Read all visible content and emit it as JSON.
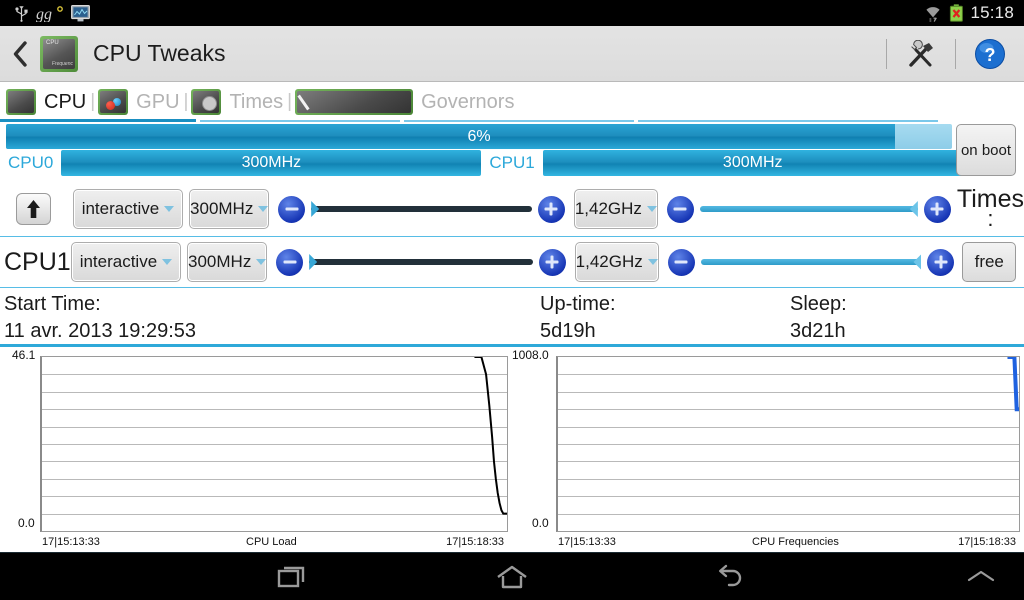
{
  "statusbar": {
    "icons": [
      "usb-icon",
      "gg-icon",
      "monitor-icon",
      "wifi-icon",
      "battery-error-icon"
    ],
    "clock": "15:18"
  },
  "actionbar": {
    "back_icon": "back-chevron-icon",
    "app_icon": "cpu-chip-icon",
    "app_icon_caption": "CPU",
    "app_icon_subcaption": "Frequenc",
    "title": "CPU Tweaks",
    "tools_icon": "tools-icon",
    "help_icon": "help-icon"
  },
  "tabs": [
    {
      "label": "CPU",
      "icon": "cpu-chip-icon",
      "active": true
    },
    {
      "label": "GPU",
      "icon": "gpu-chip-icon",
      "active": false
    },
    {
      "label": "Times",
      "icon": "times-chip-icon",
      "active": false
    },
    {
      "label": "Governors",
      "icon": "governors-chip-icon",
      "active": false
    }
  ],
  "tab_divider": "|",
  "usage": {
    "percent_label": "6%",
    "percent_value": 6,
    "fill_color": "#1e8dbd",
    "track_color": "#8ecde8"
  },
  "freq_bars": [
    {
      "tag": "CPU0",
      "value": "300MHz"
    },
    {
      "tag": "CPU1",
      "value": "300MHz"
    }
  ],
  "on_boot_button": "on boot",
  "cpu_rows": [
    {
      "row_label": "",
      "up_button_icon": "up-arrow-icon",
      "governor": "interactive",
      "min_freq": "300MHz",
      "max_freq": "1,42GHz",
      "minus_icon": "minus-icon",
      "plus_icon": "plus-icon"
    },
    {
      "row_label": "CPU1",
      "governor": "interactive",
      "min_freq": "300MHz",
      "max_freq": "1,42GHz",
      "minus_icon": "minus-icon",
      "plus_icon": "plus-icon"
    }
  ],
  "times_label": "Times",
  "times_colon": ":",
  "free_button": "free",
  "info": {
    "start_time_label": "Start Time:",
    "start_time_value": "11 avr. 2013 19:29:53",
    "uptime_label": "Up-time:",
    "uptime_value": "5d19h",
    "sleep_label": "Sleep:",
    "sleep_value": "3d21h"
  },
  "chart_data": [
    {
      "type": "line",
      "title": "CPU Load",
      "ylim": [
        0.0,
        46.1
      ],
      "ymax_label": "46.1",
      "ymin_label": "0.0",
      "x_start_label": "17|15:13:33",
      "x_end_label": "17|15:18:33",
      "grid": true,
      "gridlines": 9,
      "series": [
        {
          "name": "CPU Load",
          "color": "#000000",
          "x": [
            0.93,
            0.945,
            0.955,
            0.962,
            0.968,
            0.972,
            0.976,
            0.98,
            0.984,
            0.988,
            0.992,
            0.996,
            1.0
          ],
          "values": [
            46.1,
            46.1,
            41.5,
            33.2,
            24.9,
            18.4,
            13.8,
            10.1,
            7.4,
            5.5,
            4.6,
            4.6,
            4.6
          ]
        }
      ]
    },
    {
      "type": "line",
      "title": "CPU Frequencies",
      "ylim": [
        0.0,
        1008.0
      ],
      "ymax_label": "1008.0",
      "ymin_label": "0.0",
      "x_start_label": "17|15:13:33",
      "x_end_label": "17|15:18:33",
      "grid": true,
      "gridlines": 9,
      "series": [
        {
          "name": "CPU Frequencies",
          "color": "#1f62e0",
          "x": [
            0.975,
            0.98,
            0.985,
            0.99,
            0.995,
            1.0
          ],
          "values": [
            1008.0,
            1008.0,
            1008.0,
            1008.0,
            705.0,
            705.0
          ]
        }
      ]
    }
  ],
  "navbar": {
    "recents": "recents-icon",
    "home": "home-icon",
    "back": "back-icon",
    "chevron": "chevron-up-icon"
  }
}
